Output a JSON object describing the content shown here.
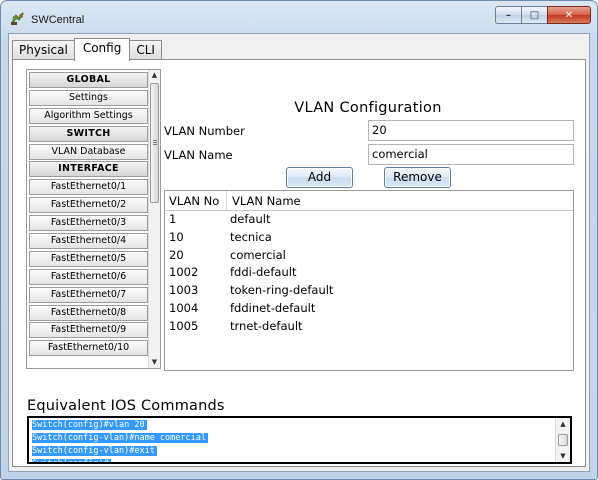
{
  "window": {
    "title": "SWCentral"
  },
  "tabs": [
    {
      "label": "Physical",
      "active": false
    },
    {
      "label": "Config",
      "active": true
    },
    {
      "label": "CLI",
      "active": false
    }
  ],
  "nav": {
    "items": [
      {
        "label": "GLOBAL",
        "header": true
      },
      {
        "label": "Settings",
        "header": false
      },
      {
        "label": "Algorithm Settings",
        "header": false
      },
      {
        "label": "SWITCH",
        "header": true
      },
      {
        "label": "VLAN Database",
        "header": false
      },
      {
        "label": "INTERFACE",
        "header": true
      },
      {
        "label": "FastEthernet0/1",
        "header": false
      },
      {
        "label": "FastEthernet0/2",
        "header": false
      },
      {
        "label": "FastEthernet0/3",
        "header": false
      },
      {
        "label": "FastEthernet0/4",
        "header": false
      },
      {
        "label": "FastEthernet0/5",
        "header": false
      },
      {
        "label": "FastEthernet0/6",
        "header": false
      },
      {
        "label": "FastEthernet0/7",
        "header": false
      },
      {
        "label": "FastEthernet0/8",
        "header": false
      },
      {
        "label": "FastEthernet0/9",
        "header": false
      },
      {
        "label": "FastEthernet0/10",
        "header": false
      }
    ]
  },
  "vlan_config": {
    "title": "VLAN Configuration",
    "number_label": "VLAN Number",
    "number_value": "20",
    "name_label": "VLAN Name",
    "name_value": "comercial",
    "add_label": "Add",
    "remove_label": "Remove",
    "table": {
      "columns": [
        "VLAN No",
        "VLAN Name"
      ],
      "rows": [
        [
          "1",
          "default"
        ],
        [
          "10",
          "tecnica"
        ],
        [
          "20",
          "comercial"
        ],
        [
          "1002",
          "fddi-default"
        ],
        [
          "1003",
          "token-ring-default"
        ],
        [
          "1004",
          "fddinet-default"
        ],
        [
          "1005",
          "trnet-default"
        ]
      ]
    }
  },
  "ios": {
    "title": "Equivalent IOS Commands",
    "lines": [
      "Switch(config)#vlan 20",
      "Switch(config-vlan)#name comercial",
      "Switch(config-vlan)#exit",
      "Switch(config)#"
    ]
  },
  "colors": {
    "selection": "#3399ff",
    "close_button": "#c2391f",
    "frame": "#c9d9ec"
  },
  "icons": [
    "switch-app-icon",
    "minimize-icon",
    "maximize-icon",
    "close-icon",
    "scroll-up-icon",
    "scroll-down-icon"
  ]
}
